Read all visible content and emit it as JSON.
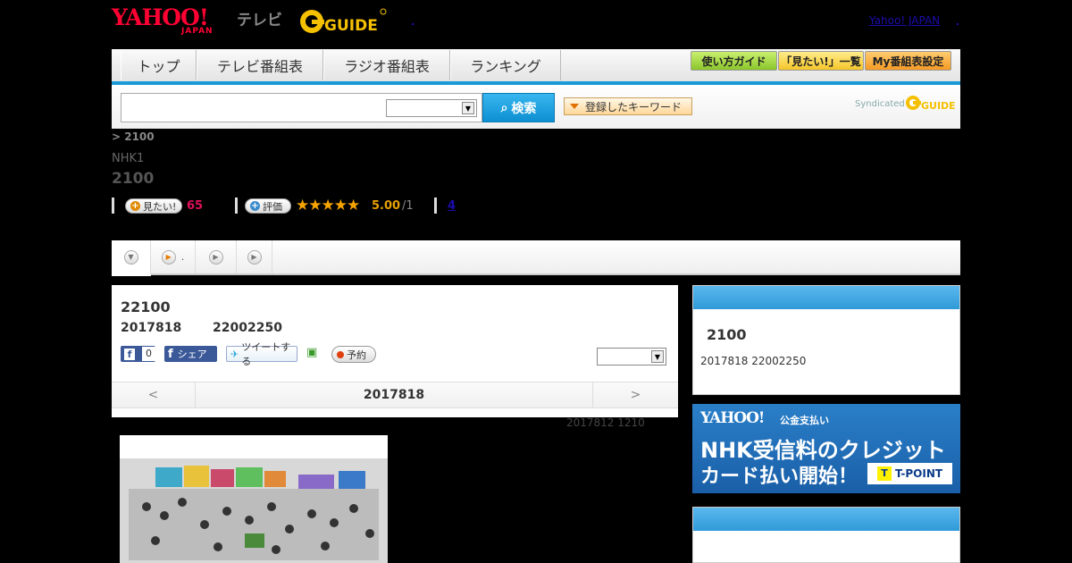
{
  "header": {
    "yahoo_logo": "YAHOO!",
    "yahoo_japan": "JAPAN",
    "tv_label": "テレビ",
    "gguide_logo": "GUIDE",
    "yahoo_japan_link": "Yahoo! JAPAN"
  },
  "nav": {
    "tabs": [
      "トップ",
      "テレビ番組表",
      "ラジオ番組表",
      "ランキング"
    ],
    "buttons": [
      "使い方ガイド",
      "「見たい!」一覧",
      "My番組表設定"
    ],
    "colors": {
      "accent": "#1a9ad6",
      "green": "#8bc62b",
      "yellow": "#f5c52a",
      "orange": "#f59a24"
    }
  },
  "search": {
    "input_value": "",
    "select_value": "",
    "button_label": "検索",
    "keyword_button": "登録したキーワード",
    "syndicated": "Syndicated"
  },
  "program": {
    "breadcrumb": "> 2100",
    "channel": "NHK1",
    "title": "2100",
    "want_label": "見たい!",
    "want_count": "65",
    "rate_label": "評価",
    "stars": "★★★★★",
    "rating": "5.00",
    "rating_den": "/1",
    "link_count": "4"
  },
  "tabs": {
    "item2_dot": "."
  },
  "card": {
    "title": "22100",
    "date": "2017818",
    "time": "22002250",
    "fb_count": "0",
    "fb_share": "シェア",
    "tweet": "ツイートする",
    "rec": "予約",
    "prev": "<",
    "next": ">",
    "nav_date": "2017818"
  },
  "updated": "2017812  1210",
  "sidebar": {
    "title": "2100",
    "sub": "2017818  22002250"
  },
  "banner": {
    "yahoo": "YAHOO!",
    "small": "公金支払い",
    "line1": "NHK受信料のクレジット",
    "line2": "カード払い開始！",
    "tpoint": "T-POINT"
  }
}
